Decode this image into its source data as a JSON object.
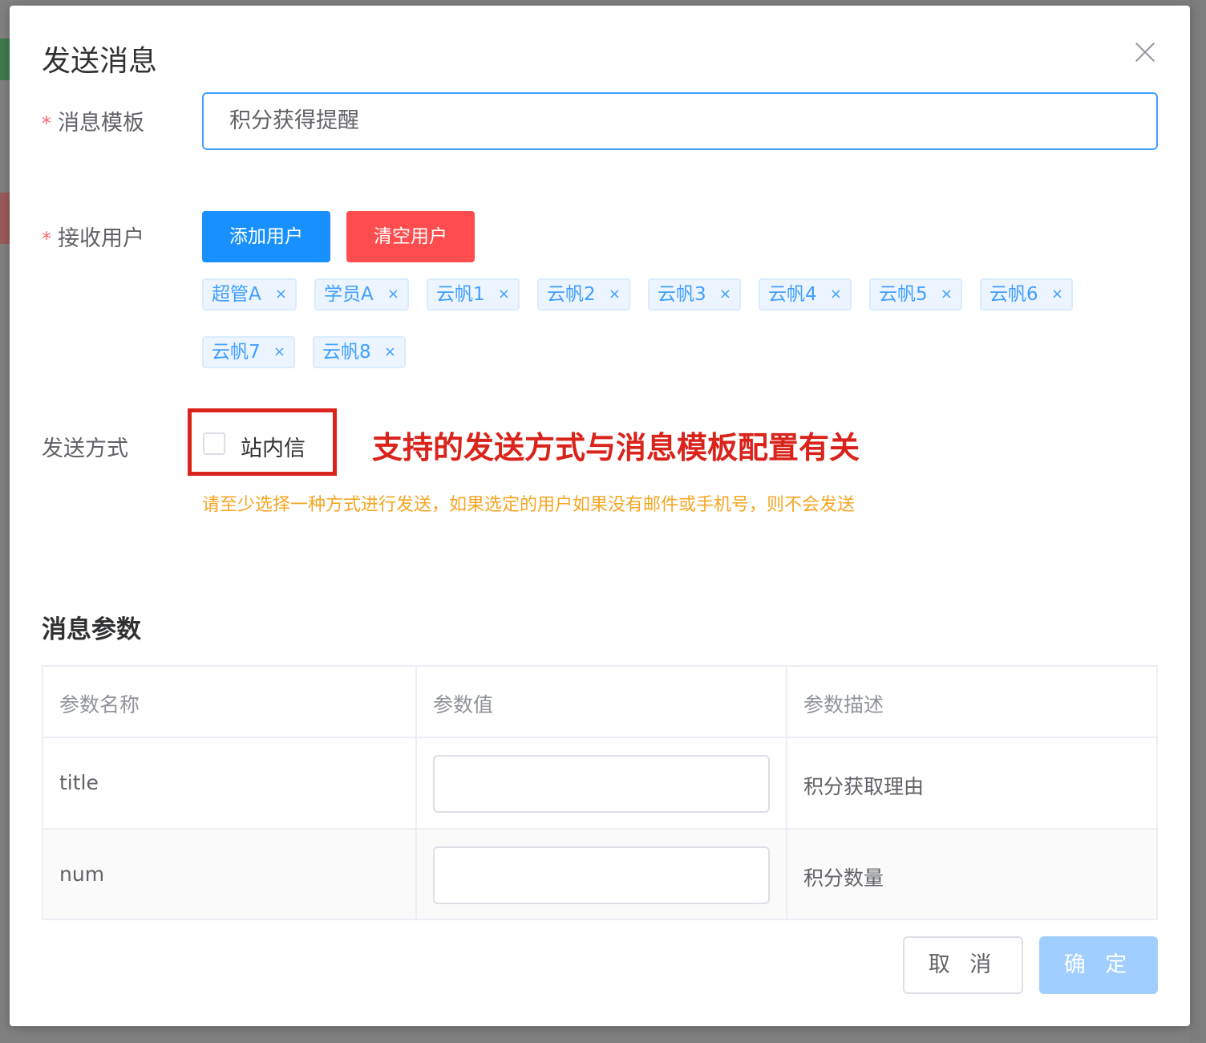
{
  "dialog": {
    "title": "发送消息",
    "close_icon": "close-icon"
  },
  "form": {
    "template_label": "消息模板",
    "template_value": "积分获得提醒",
    "receivers_label": "接收用户",
    "add_button": "添加用户",
    "clear_button": "清空用户",
    "tags": [
      {
        "label": "超管A"
      },
      {
        "label": "学员A"
      },
      {
        "label": "云帆1"
      },
      {
        "label": "云帆2"
      },
      {
        "label": "云帆3"
      },
      {
        "label": "云帆4"
      },
      {
        "label": "云帆5"
      },
      {
        "label": "云帆6"
      },
      {
        "label": "云帆7"
      },
      {
        "label": "云帆8"
      }
    ],
    "tag_close": "×",
    "method_label": "发送方式",
    "method_option": "站内信",
    "method_checked": false,
    "annotation": "支持的发送方式与消息模板配置有关",
    "hint": "请至少选择一种方式进行发送，如果选定的用户如果没有邮件或手机号，则不会发送"
  },
  "params": {
    "section_title": "消息参数",
    "headers": [
      "参数名称",
      "参数值",
      "参数描述"
    ],
    "rows": [
      {
        "name": "title",
        "value": "",
        "desc": "积分获取理由"
      },
      {
        "name": "num",
        "value": "",
        "desc": "积分数量"
      }
    ]
  },
  "footer": {
    "cancel": "取 消",
    "confirm": "确 定"
  },
  "colors": {
    "primary": "#409eff",
    "danger": "#ff4d4f",
    "annotation": "#d9231b",
    "hint": "#f5a623"
  }
}
